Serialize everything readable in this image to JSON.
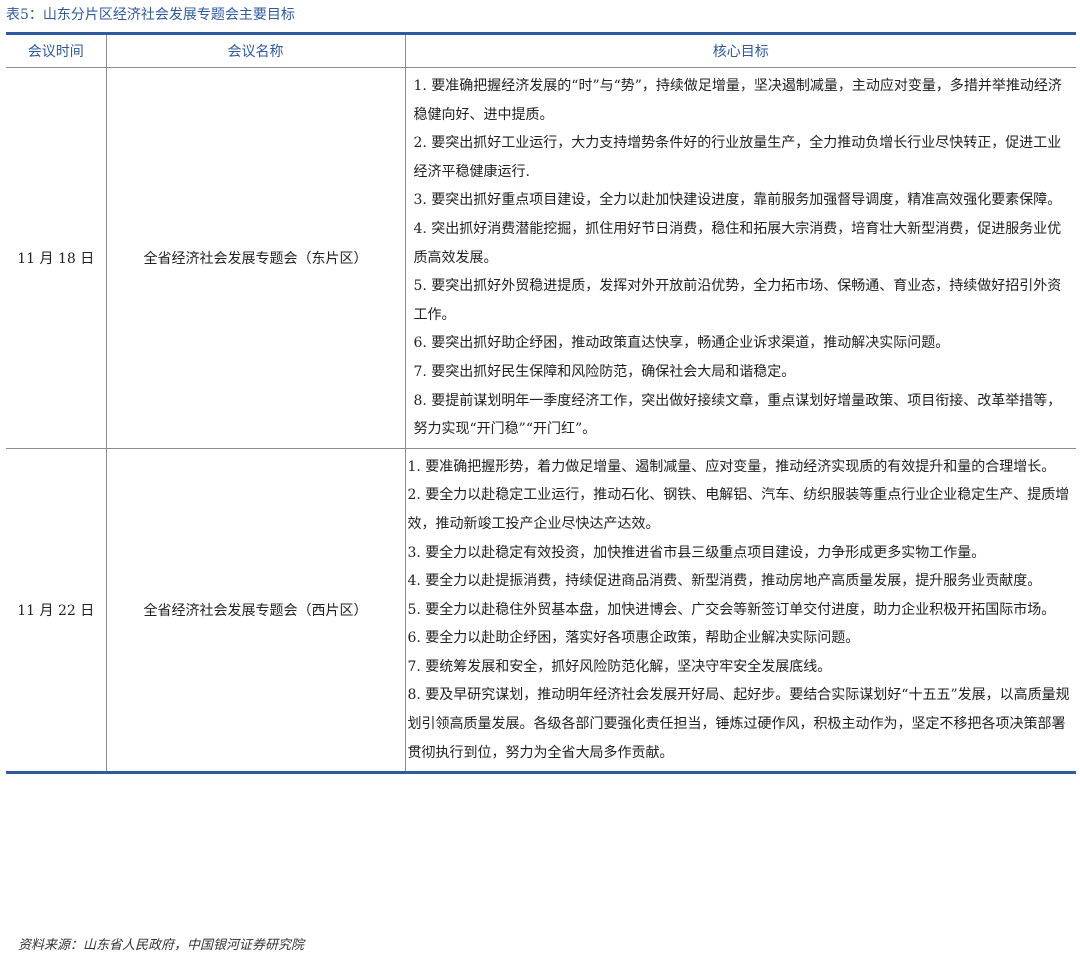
{
  "caption": "表5：山东分片区经济社会发展专题会主要目标",
  "table": {
    "headers": [
      "会议时间",
      "会议名称",
      "核心目标"
    ],
    "rows": [
      {
        "date": "11 月 18 日",
        "name": "全省经济社会发展专题会（东片区）",
        "goals": [
          "1. 要准确把握经济发展的“时”与“势”，持续做足增量，坚决遏制减量，主动应对变量，多措并举推动经济稳健向好、进中提质。",
          "2. 要突出抓好工业运行，大力支持增势条件好的行业放量生产，全力推动负增长行业尽快转正，促进工业经济平稳健康运行.",
          "3. 要突出抓好重点项目建设，全力以赴加快建设进度，靠前服务加强督导调度，精准高效强化要素保障。",
          "4. 突出抓好消费潜能挖掘，抓住用好节日消费，稳住和拓展大宗消费，培育壮大新型消费，促进服务业优质高效发展。",
          "5. 要突出抓好外贸稳进提质，发挥对外开放前沿优势，全力拓市场、保畅通、育业态，持续做好招引外资工作。",
          "6. 要突出抓好助企纾困，推动政策直达快享，畅通企业诉求渠道，推动解决实际问题。",
          "7. 要突出抓好民生保障和风险防范，确保社会大局和谐稳定。",
          "8. 要提前谋划明年一季度经济工作，突出做好接续文章，重点谋划好增量政策、项目衔接、改革举措等，努力实现“开门稳”“开门红”。"
        ]
      },
      {
        "date": "11 月 22 日",
        "name": "全省经济社会发展专题会（西片区）",
        "goals": [
          "1. 要准确把握形势，着力做足增量、遏制减量、应对变量，推动经济实现质的有效提升和量的合理增长。",
          "2. 要全力以赴稳定工业运行，推动石化、钢铁、电解铝、汽车、纺织服装等重点行业企业稳定生产、提质增效，推动新竣工投产企业尽快达产达效。",
          "3. 要全力以赴稳定有效投资，加快推进省市县三级重点项目建设，力争形成更多实物工作量。",
          "4. 要全力以赴提振消费，持续促进商品消费、新型消费，推动房地产高质量发展，提升服务业贡献度。",
          "5. 要全力以赴稳住外贸基本盘，加快进博会、广交会等新签订单交付进度，助力企业积极开拓国际市场。",
          "6. 要全力以赴助企纾困，落实好各项惠企政策，帮助企业解决实际问题。",
          "7. 要统筹发展和安全，抓好风险防范化解，坚决守牢安全发展底线。",
          "8. 要及早研究谋划，推动明年经济社会发展开好局、起好步。要结合实际谋划好“十五五”发展，以高质量规划引领高质量发展。各级各部门要强化责任担当，锤炼过硬作风，积极主动作为，坚定不移把各项决策部署贯彻执行到位，努力为全省大局多作贡献。"
        ]
      }
    ]
  },
  "source": "资料来源：山东省人民政府，中国银河证券研究院",
  "colors": {
    "accent": "#2f5aa0",
    "rule": "#8c8c8c",
    "text": "#222222"
  }
}
